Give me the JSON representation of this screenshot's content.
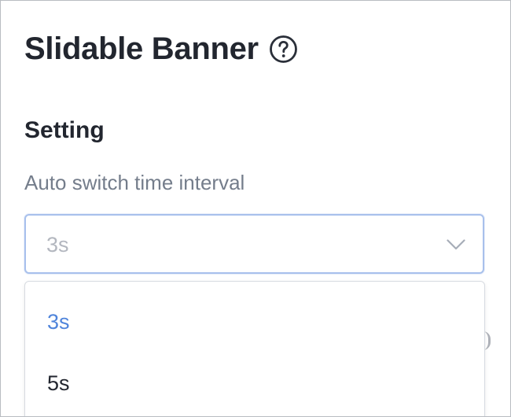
{
  "header": {
    "title": "Slidable Banner",
    "help_icon": "question-circle-icon"
  },
  "setting": {
    "section_title": "Setting",
    "auto_switch": {
      "label": "Auto switch time interval",
      "selected_value": "3s",
      "options": [
        "3s",
        "5s"
      ]
    }
  },
  "colors": {
    "accent": "#4f84db",
    "select_border": "#a8c0ec",
    "label_gray": "#747d8b"
  }
}
